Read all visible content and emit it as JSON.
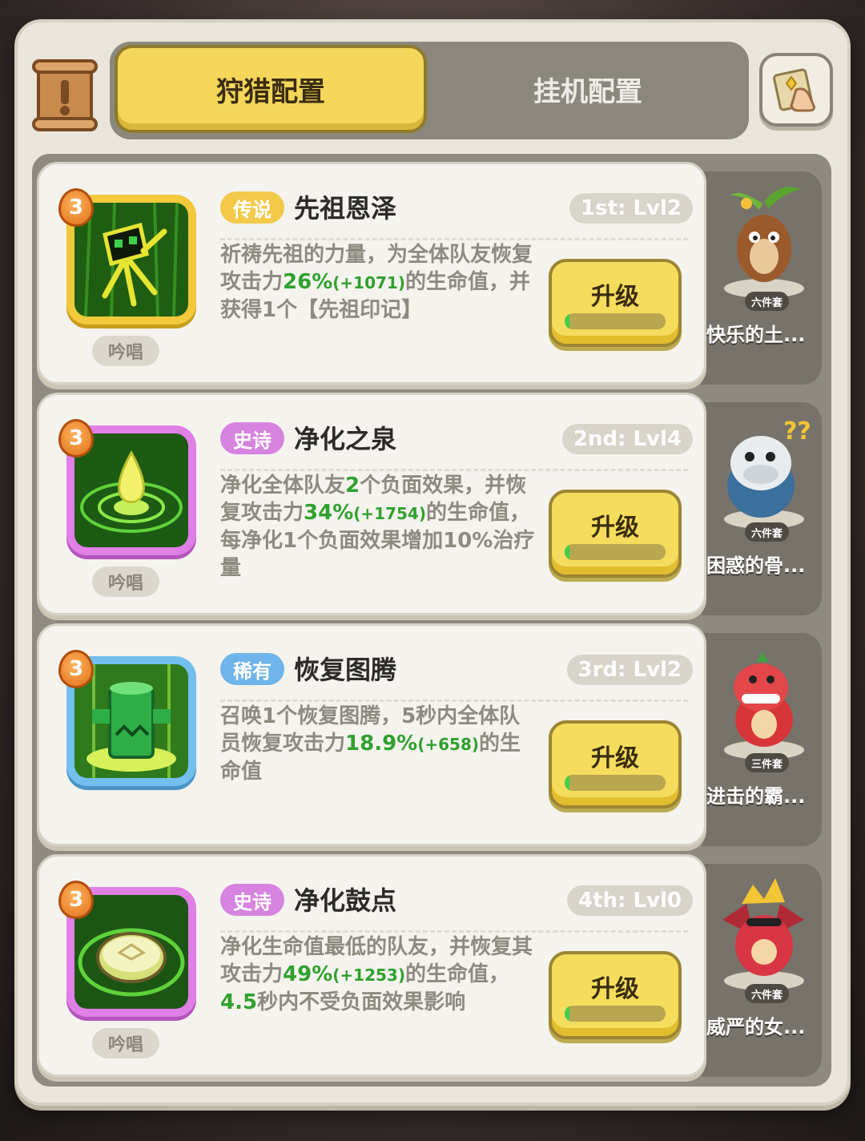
{
  "tabs": {
    "hunt": "狩猎配置",
    "idle": "挂机配置"
  },
  "icons": {
    "scroll": "scroll-alert-icon",
    "map": "map-hand-icon"
  },
  "skills": [
    {
      "rarity": "传说",
      "rarity_color": "#f3c94a",
      "name": "先祖恩泽",
      "level": "1st: Lvl2",
      "cost": "3",
      "tag": "吟唱",
      "desc_pre": "祈祷先祖的力量，为全体队友恢复攻击力",
      "v1": "26%",
      "v2": "(+1071)",
      "desc_post": "的生命值，并获得1个【先祖印记】",
      "upgrade": "升级",
      "progress": 0.05,
      "set": "六件套",
      "pet": "快乐的土..."
    },
    {
      "rarity": "史诗",
      "rarity_color": "#d784e0",
      "name": "净化之泉",
      "level": "2nd: Lvl4",
      "cost": "3",
      "tag": "吟唱",
      "desc_a": "净化全体队友",
      "n1": "2",
      "desc_b": "个负面效果，并恢复攻击力",
      "v1": "34%",
      "v2": "(+1754)",
      "desc_post": "的生命值，每净化1个负面效果增加10%治疗量",
      "upgrade": "升级",
      "progress": 0.05,
      "set": "六件套",
      "pet": "困惑的骨..."
    },
    {
      "rarity": "稀有",
      "rarity_color": "#6fb4ea",
      "name": "恢复图腾",
      "level": "3rd: Lvl2",
      "cost": "3",
      "tag": "",
      "desc_pre": "召唤1个恢复图腾，5秒内全体队员恢复攻击力",
      "v1": "18.9%",
      "v2": "(+658)",
      "desc_post": "的生命值",
      "upgrade": "升级",
      "progress": 0.05,
      "set": "三件套",
      "pet": "进击的霸..."
    },
    {
      "rarity": "史诗",
      "rarity_color": "#d784e0",
      "name": "净化鼓点",
      "level": "4th: Lvl0",
      "cost": "3",
      "tag": "吟唱",
      "desc_pre": "净化生命值最低的队友，并恢复其攻击力",
      "v1": "49%",
      "v2": "(+1253)",
      "desc_mid": "的生命值，",
      "v3": "4.5",
      "desc_post": "秒内不受负面效果影响",
      "upgrade": "升级",
      "progress": 0.05,
      "set": "六件套",
      "pet": "威严的女..."
    }
  ]
}
